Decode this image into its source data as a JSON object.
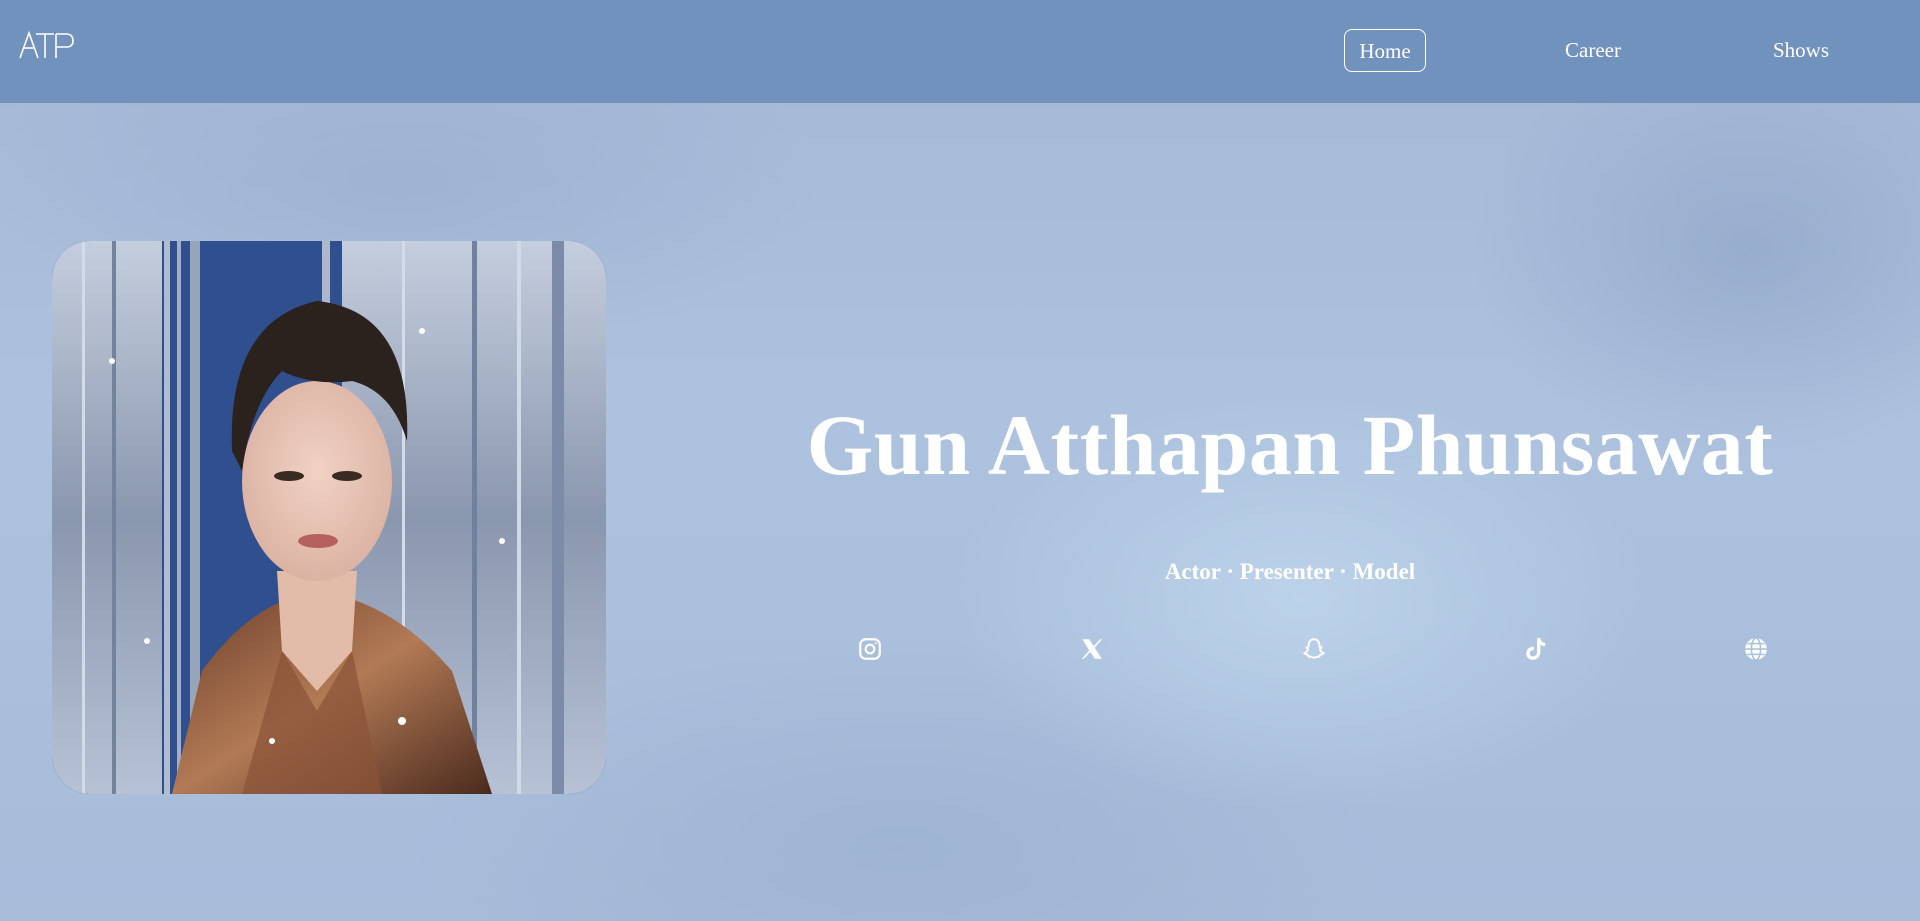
{
  "header": {
    "logo_text": "ATP",
    "nav": [
      {
        "label": "Home",
        "active": true
      },
      {
        "label": "Career",
        "active": false
      },
      {
        "label": "Shows",
        "active": false
      }
    ]
  },
  "hero": {
    "name": "Gun Atthapan Phunsawat",
    "roles": "Actor · Presenter · Model",
    "portrait_icon": "portrait-photo"
  },
  "social": [
    {
      "icon": "instagram-icon"
    },
    {
      "icon": "x-twitter-icon"
    },
    {
      "icon": "snapchat-icon"
    },
    {
      "icon": "tiktok-icon"
    },
    {
      "icon": "globe-icon"
    }
  ],
  "colors": {
    "nav_bg": "#7292be",
    "page_bg": "#a9bfdb",
    "text": "#ffffff"
  }
}
